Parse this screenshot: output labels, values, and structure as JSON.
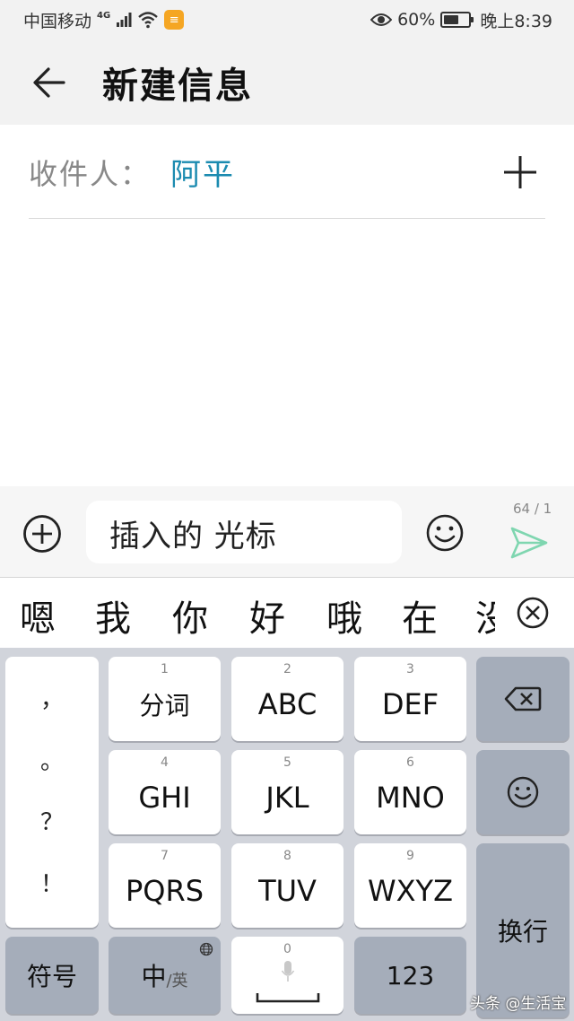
{
  "status_bar": {
    "carrier": "中国移动",
    "network": "4G",
    "battery_percent": "60%",
    "battery_level": 0.6,
    "time": "晚上8:39",
    "icons": [
      "signal-icon",
      "wifi-icon",
      "notification-icon",
      "eye-icon",
      "battery-icon"
    ]
  },
  "header": {
    "title": "新建信息",
    "back_icon": "back-arrow-icon"
  },
  "recipient": {
    "label": "收件人：",
    "name": "阿平",
    "add_icon": "plus-icon"
  },
  "composer": {
    "input_value": "插入的 光标",
    "counter": "64 / 1",
    "attach_icon": "circle-plus-icon",
    "emoji_icon": "smiley-icon",
    "send_icon": "send-icon",
    "send_color": "#7fd6b0"
  },
  "candidates": {
    "items": [
      "嗯",
      "我",
      "你",
      "好",
      "哦",
      "在",
      "没"
    ],
    "clear_icon": "circle-x-icon"
  },
  "keyboard": {
    "punctuation": [
      "，",
      "。",
      "？",
      "！"
    ],
    "keys": [
      {
        "num": "1",
        "label": "分词"
      },
      {
        "num": "2",
        "label": "ABC"
      },
      {
        "num": "3",
        "label": "DEF"
      },
      {
        "num": "4",
        "label": "GHI"
      },
      {
        "num": "5",
        "label": "JKL"
      },
      {
        "num": "6",
        "label": "MNO"
      },
      {
        "num": "7",
        "label": "PQRS"
      },
      {
        "num": "8",
        "label": "TUV"
      },
      {
        "num": "9",
        "label": "WXYZ"
      }
    ],
    "backspace_icon": "backspace-icon",
    "emoji_icon": "smiley-icon",
    "enter_label": "换行",
    "symbols_label": "符号",
    "lang_main": "中",
    "lang_sub": "/英",
    "space_num": "0",
    "numbers_label": "123",
    "mic_icon": "microphone-icon",
    "globe_icon": "globe-icon"
  },
  "watermark": "头条 @生活宝"
}
